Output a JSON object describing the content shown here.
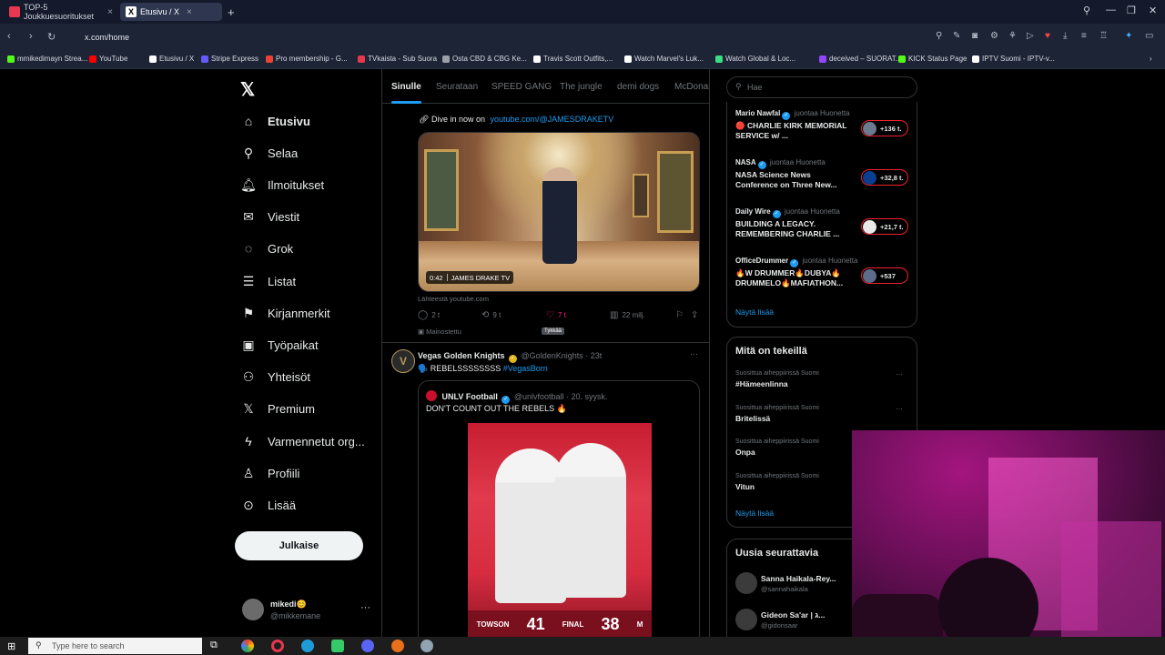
{
  "browser": {
    "tabs": [
      {
        "label": "TOP-5 Joukkuesuoritukset",
        "color": "#e8384f"
      },
      {
        "label": "Etusivu / X",
        "color": "#ffffff"
      }
    ],
    "url": "x.com/home",
    "bookmarks": [
      {
        "label": "mmikedimayn Strea...",
        "color": "#53fc18"
      },
      {
        "label": "YouTube",
        "color": "#ff0000"
      },
      {
        "label": "Etusivu / X",
        "color": "#ffffff"
      },
      {
        "label": "Stripe Express",
        "color": "#635bff"
      },
      {
        "label": "Pro membership - G...",
        "color": "#ea4335"
      },
      {
        "label": "TVkaista - Sub Suora",
        "color": "#e8384f"
      },
      {
        "label": "Osta CBD & CBG Ke...",
        "color": "#9aa0a6"
      },
      {
        "label": "Travis Scott Outfits,...",
        "color": "#ffffff"
      },
      {
        "label": "Watch Marvel's Luk...",
        "color": "#ffffff"
      },
      {
        "label": "Watch Global & Loc...",
        "color": "#3ddc84"
      },
      {
        "label": "deceived – SUORAT...",
        "color": "#9146ff"
      },
      {
        "label": "KICK Status Page",
        "color": "#53fc18"
      },
      {
        "label": "IPTV Suomi - IPTV-v...",
        "color": "#ffffff"
      }
    ]
  },
  "nav": {
    "items": [
      {
        "label": "Etusivu",
        "icon": "⌂"
      },
      {
        "label": "Selaa",
        "icon": "⚲"
      },
      {
        "label": "Ilmoitukset",
        "icon": "🔔︎"
      },
      {
        "label": "Viestit",
        "icon": "✉"
      },
      {
        "label": "Grok",
        "icon": "◌"
      },
      {
        "label": "Listat",
        "icon": "☰"
      },
      {
        "label": "Kirjanmerkit",
        "icon": "⚑"
      },
      {
        "label": "Työpaikat",
        "icon": "▣"
      },
      {
        "label": "Yhteisöt",
        "icon": "⚇"
      },
      {
        "label": "Premium",
        "icon": "𝕏"
      },
      {
        "label": "Varmennetut org...",
        "icon": "ϟ"
      },
      {
        "label": "Profiili",
        "icon": "♙"
      },
      {
        "label": "Lisää",
        "icon": "⊙"
      }
    ],
    "post_button": "Julkaise",
    "account": {
      "name": "mikedi😊",
      "handle": "@mikkemane"
    }
  },
  "feed": {
    "tabs": [
      "Sinulle",
      "Seurataan",
      "SPEED GANG",
      "The jungle",
      "demi dogs",
      "McDonal"
    ],
    "ad_post": {
      "dive_text": "Dive in now on",
      "dive_link": "youtube.com/@JAMESDRAKETV",
      "video_duration": "0:42",
      "video_channel": "JAMES DRAKE TV",
      "source": "Lähteestä youtube.com",
      "replies": "2 t",
      "reposts": "9 t",
      "likes": "7 t",
      "views": "22 milj.",
      "tooltip": "Tykkää",
      "promoted": "Mainostettu"
    },
    "post2": {
      "name": "Vegas Golden Knights",
      "meta": "@GoldenKnights · 23t",
      "text": "🗣️ REBELSSSSSSSS",
      "hashtag": "#VegasBorn",
      "quote": {
        "name": "UNLV Football",
        "meta": "@unlvfootball · 20. syysk.",
        "text": "DON'T COUNT OUT THE REBELS 🔥",
        "score": {
          "left_team": "TOWSON",
          "left": "41",
          "status": "FINAL",
          "right": "38",
          "right_team": "M"
        }
      }
    }
  },
  "sidebar": {
    "search_placeholder": "Hae",
    "live": [
      {
        "name": "Mario Nawfal",
        "host": "juontaa Huonetta",
        "title": "🔴 CHARLIE KIRK MEMORIAL SERVICE w/ ...",
        "count": "+136 t."
      },
      {
        "name": "NASA",
        "host": "juontaa Huonetta",
        "title": "NASA Science News Conference on Three New...",
        "count": "+32,8 t."
      },
      {
        "name": "Daily Wire",
        "host": "juontaa Huonetta",
        "title": "BUILDING A LEGACY. REMEMBERING CHARLIE ...",
        "count": "+21,7 t."
      },
      {
        "name": "OfficeDrummer",
        "host": "juontaa Huonetta",
        "title": "🔥W DRUMMER🔥DUBYA🔥 DRUMMELO🔥MAFIATHON...",
        "count": "+537"
      }
    ],
    "show_more": "Näytä lisää",
    "trends_title": "Mitä on tekeillä",
    "trends": [
      {
        "context": "Suosittua aiheppiirissä Suomi",
        "title": "#Hämeenlinna"
      },
      {
        "context": "Suosittua aiheppiirissä Suomi",
        "title": "Britelissä"
      },
      {
        "context": "Suosittua aiheppiirissä Suomi",
        "title": "Onpa"
      },
      {
        "context": "Suosittua aiheppiirissä Suomi",
        "title": "Vitun"
      }
    ],
    "who_title": "Uusia seurattavia",
    "who": [
      {
        "name": "Sanna Haikala-Rey...",
        "handle": "@sannahaikala"
      },
      {
        "name": "Gideon Sa'ar | ג...",
        "handle": "@gidonsaar"
      }
    ]
  },
  "taskbar": {
    "search_placeholder": "Type here to search"
  }
}
